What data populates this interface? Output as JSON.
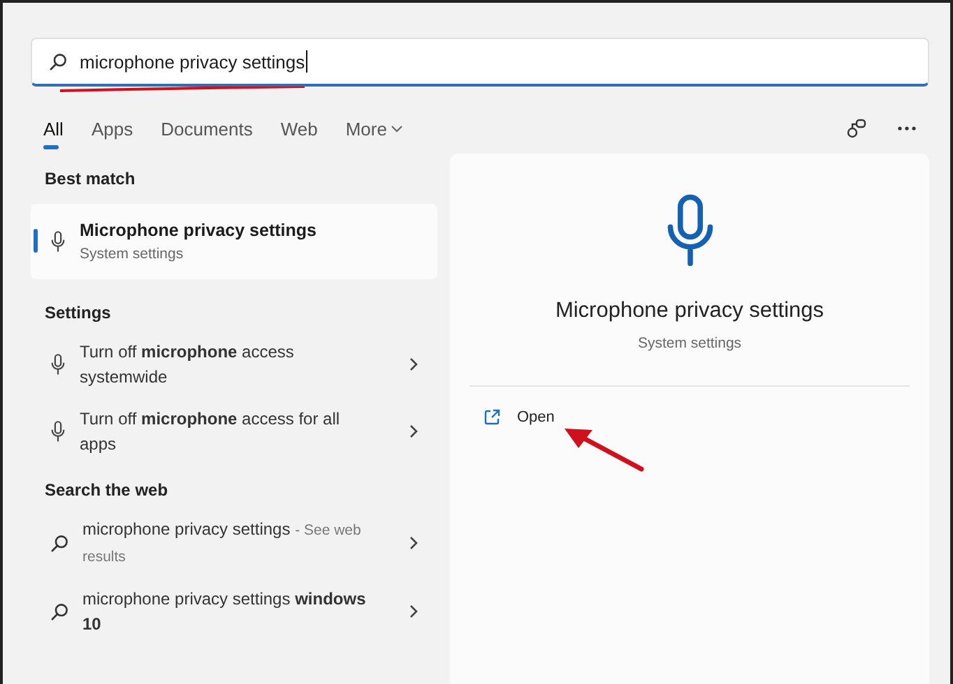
{
  "search": {
    "value": "microphone privacy settings"
  },
  "tabs": [
    {
      "label": "All",
      "selected": true,
      "kind": "plain"
    },
    {
      "label": "Apps",
      "selected": false,
      "kind": "plain"
    },
    {
      "label": "Documents",
      "selected": false,
      "kind": "plain"
    },
    {
      "label": "Web",
      "selected": false,
      "kind": "plain"
    },
    {
      "label": "More",
      "selected": false,
      "kind": "menu"
    }
  ],
  "best_match": {
    "heading": "Best match",
    "items": [
      {
        "title": "Microphone privacy settings",
        "subtitle": "System settings",
        "selected": true
      }
    ]
  },
  "settings": {
    "heading": "Settings",
    "items": [
      {
        "text": "Turn off **microphone** access systemwide"
      },
      {
        "text": "Turn off **microphone** access for all apps"
      }
    ]
  },
  "web": {
    "heading": "Search the web",
    "items": [
      {
        "text": "microphone privacy settings",
        "note": "- See web results"
      },
      {
        "text": "microphone privacy settings **windows 10**"
      }
    ]
  },
  "detail": {
    "title": "Microphone privacy settings",
    "subtitle": "System settings",
    "actions": [
      {
        "label": "Open"
      }
    ]
  }
}
